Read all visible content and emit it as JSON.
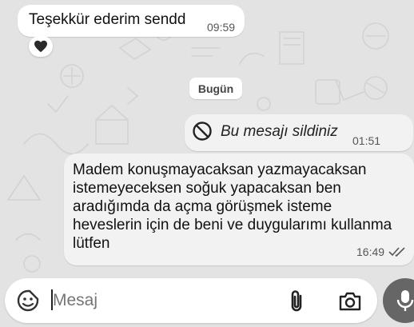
{
  "chat": {
    "incoming": {
      "text": "Teşekkür ederim sendd",
      "time": "09:59",
      "reaction_icon": "black-heart-icon"
    },
    "date_separator": "Bugün",
    "deleted_message": {
      "text": "Bu mesajı sildiniz",
      "time": "01:51",
      "icon": "prohibited-icon"
    },
    "outgoing": {
      "lines": [
        "Madem  konuşmayacaksan yazmayacaksan",
        "istemeyeceksen soğuk yapacaksan  ben",
        "aradığımda da  açma görüşmek isteme",
        "heveslerin için de beni ve duygularımı kullanma",
        "lütfen"
      ],
      "time": "16:49",
      "status_icon": "double-check-icon"
    }
  },
  "composer": {
    "placeholder": "Mesaj",
    "sticker_icon": "sticker-icon",
    "attach_icon": "paperclip-icon",
    "camera_icon": "camera-icon",
    "mic_icon": "microphone-icon"
  },
  "colors": {
    "background": "#e3e3e3",
    "bubble_incoming": "#ffffff",
    "bubble_outgoing": "#f2f2f2",
    "mic_button": "#666666"
  }
}
